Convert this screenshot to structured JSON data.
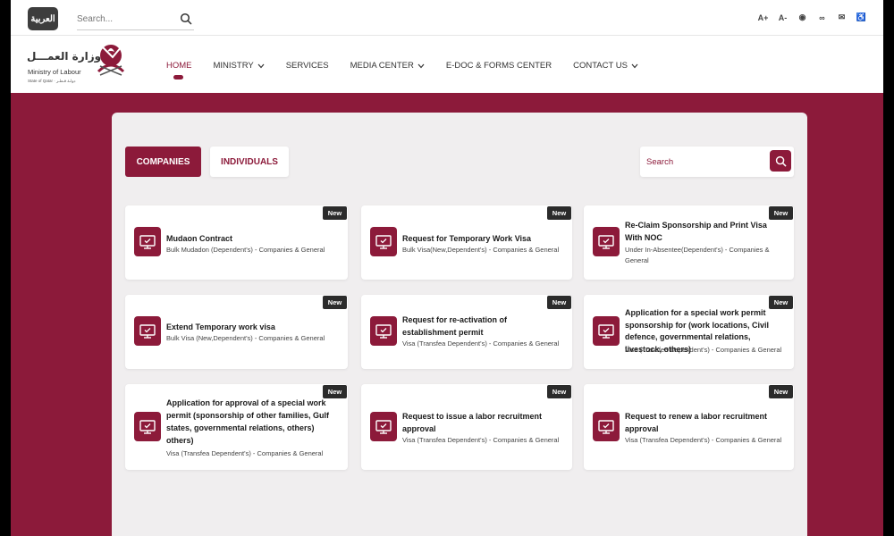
{
  "topbar": {
    "lang_label": "العربية",
    "search_placeholder": "Search...",
    "icons": [
      "text-increase-icon",
      "text-decrease-icon",
      "eye-icon",
      "link-icon",
      "mail-icon",
      "accessibility-icon"
    ],
    "icon_glyphs": [
      "A+",
      "A-",
      "◉",
      "∞",
      "✉",
      "♿"
    ]
  },
  "logo": {
    "arabic": "وزارة العمـــل",
    "english": "Ministry of Labour",
    "sub": "State of Qatar · دولـة قـطـر"
  },
  "nav": {
    "items": [
      {
        "label": "HOME",
        "active": true,
        "dropdown": false
      },
      {
        "label": "MINISTRY",
        "active": false,
        "dropdown": true
      },
      {
        "label": "SERVICES",
        "active": false,
        "dropdown": false
      },
      {
        "label": "MEDIA CENTER",
        "active": false,
        "dropdown": true
      },
      {
        "label": "E-DOC & FORMS CENTER",
        "active": false,
        "dropdown": false
      },
      {
        "label": "CONTACT US",
        "active": false,
        "dropdown": true
      }
    ]
  },
  "tabs": {
    "companies": "COMPANIES",
    "individuals": "INDIVIDUALS"
  },
  "service_search": {
    "placeholder": "Search"
  },
  "colors": {
    "brand": "#8c1a3a",
    "badge": "#2b2b2b"
  },
  "cards": [
    {
      "title": "Mudaon Contract",
      "subtitle": "Bulk Mudadon (Dependent's) - Companies & General",
      "badge": "New"
    },
    {
      "title": "Request for Temporary Work Visa",
      "subtitle": "Bulk Visa(New,Dependent's) - Companies & General",
      "badge": "New"
    },
    {
      "title": "Re-Claim Sponsorship and Print Visa With NOC",
      "subtitle": "Under In-Absentee(Dependent's) - Companies & General",
      "badge": "New"
    },
    {
      "title": "Extend Temporary work visa",
      "subtitle": "Bulk Visa (New,Dependent's) - Companies & General",
      "badge": "New"
    },
    {
      "title": "Request for re-activation of establishment permit",
      "subtitle": "Visa (Transfea Dependent's) - Companies & General",
      "badge": "New"
    },
    {
      "title": "Application for a special work permit sponsorship for (work locations, Civil defence, governmental relations, livestock, others)",
      "subtitle": "Visa (Transfea Dependent's) - Companies & General",
      "badge": "New"
    },
    {
      "title": "Application for approval of a special work permit (sponsorship of other families, Gulf states, governmental relations, others) others)",
      "subtitle": "Visa (Transfea Dependent's) - Companies & General",
      "badge": "New"
    },
    {
      "title": "Request to issue a labor recruitment approval",
      "subtitle": "Visa (Transfea Dependent's) - Companies & General",
      "badge": "New"
    },
    {
      "title": "Request to renew a labor recruitment approval",
      "subtitle": "Visa (Transfea Dependent's) - Companies & General",
      "badge": "New"
    }
  ]
}
